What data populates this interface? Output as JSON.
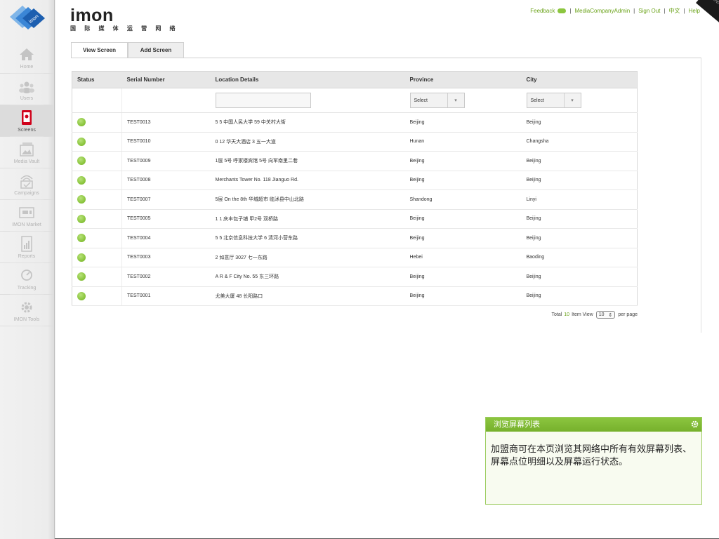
{
  "logo": {
    "badge_text": "imon"
  },
  "brand": {
    "name": "imon",
    "subtitle": "国 际 媒 体 运 营 网 络"
  },
  "toplinks": {
    "feedback": "Feedback",
    "user": "MediaCompanyAdmin",
    "sign_out": "Sign Out",
    "language": "中文",
    "help": "Help",
    "ribbon": "OPEN"
  },
  "sidebar": {
    "items": [
      {
        "label": "Home",
        "icon": "home-icon"
      },
      {
        "label": "Users",
        "icon": "users-icon"
      },
      {
        "label": "Screens",
        "icon": "screen-icon",
        "active": true
      },
      {
        "label": "Media Vault",
        "icon": "media-vault-icon"
      },
      {
        "label": "Campaigns",
        "icon": "campaigns-icon"
      },
      {
        "label": "IMON Market",
        "icon": "market-icon"
      },
      {
        "label": "Reports",
        "icon": "reports-icon"
      },
      {
        "label": "Tracking",
        "icon": "tracking-icon"
      },
      {
        "label": "IMON Tools",
        "icon": "tools-icon"
      }
    ]
  },
  "tabs": [
    {
      "label": "View Screen",
      "active": true
    },
    {
      "label": "Add Screen",
      "active": false
    }
  ],
  "table": {
    "columns": [
      "Status",
      "Serial Number",
      "Location Details",
      "Province",
      "City"
    ],
    "filters": {
      "location_placeholder": "",
      "province_select": "Select",
      "city_select": "Select"
    },
    "rows": [
      {
        "status": "online",
        "serial": "TEST0013",
        "location": "5 5 中国人民大学 59 中关村大街",
        "province": "Beijing",
        "city": "Beijing"
      },
      {
        "status": "online",
        "serial": "TEST0010",
        "location": "0 12 华天大酒店 3 五一大道",
        "province": "Hunan",
        "city": "Changsha"
      },
      {
        "status": "online",
        "serial": "TEST0009",
        "location": "1层 5号 呼家楼宾馆 5号 向军南里二巷",
        "province": "Beijing",
        "city": "Beijing"
      },
      {
        "status": "online",
        "serial": "TEST0008",
        "location": "Merchants Tower No. 118 Jianguo Rd.",
        "province": "Beijing",
        "city": "Beijing"
      },
      {
        "status": "online",
        "serial": "TEST0007",
        "location": "5层 On the 8th 华城超市 临沭县中山北路",
        "province": "Shandong",
        "city": "Linyi"
      },
      {
        "status": "online",
        "serial": "TEST0005",
        "location": "1 1 庆丰包子铺 甲2号 双桥路",
        "province": "Beijing",
        "city": "Beijing"
      },
      {
        "status": "online",
        "serial": "TEST0004",
        "location": "5 5 北京信息科技大学 6 清河小营东路",
        "province": "Beijing",
        "city": "Beijing"
      },
      {
        "status": "online",
        "serial": "TEST0003",
        "location": "2 如意厅 3027 七一东路",
        "province": "Hebei",
        "city": "Baoding"
      },
      {
        "status": "online",
        "serial": "TEST0002",
        "location": "A R & F City No. 55 东三环路",
        "province": "Beijing",
        "city": "Beijing"
      },
      {
        "status": "online",
        "serial": "TEST0001",
        "location": "尤美大厦 48 长阳路口",
        "province": "Beijing",
        "city": "Beijing"
      }
    ]
  },
  "pager": {
    "total_label": "Total",
    "total": "10",
    "item_view_label": "Item View",
    "per_page_value": "10",
    "per_page_label": "per page"
  },
  "help_panel": {
    "title": "浏览屏幕列表",
    "body": "加盟商可在本页浏览其网络中所有有效屏幕列表、屏幕点位明细以及屏幕运行状态。"
  },
  "colors": {
    "accent": "#8cc63f",
    "link": "#6ba31a",
    "status_online": "#8cc63f"
  }
}
